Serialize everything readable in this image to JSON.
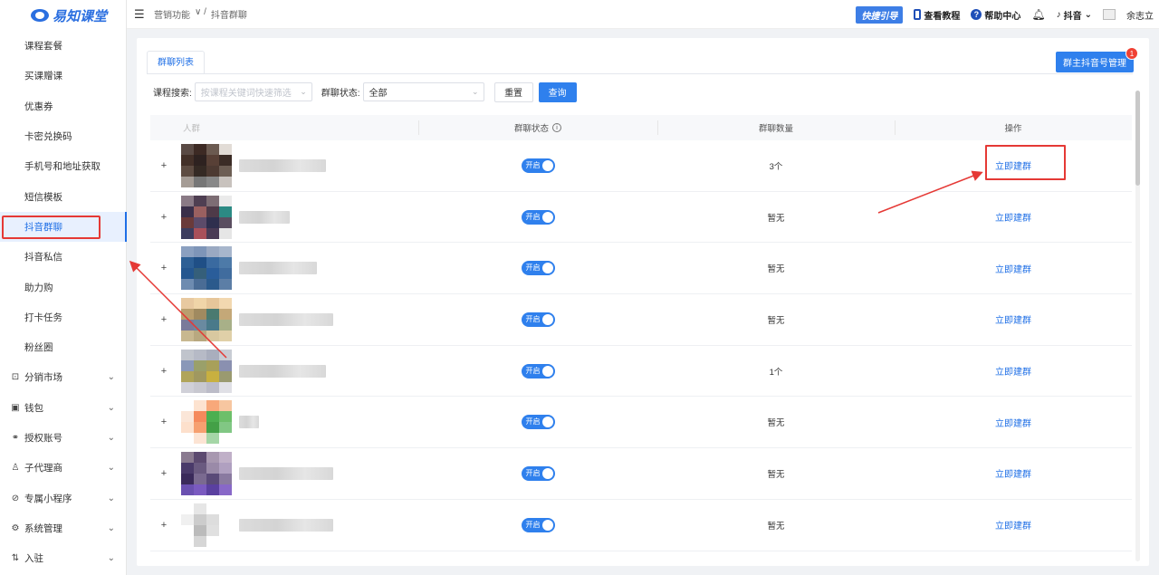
{
  "brand": {
    "name": "易知课堂"
  },
  "sidebar": {
    "items": [
      {
        "label": "课程套餐"
      },
      {
        "label": "买课赠课"
      },
      {
        "label": "优惠券"
      },
      {
        "label": "卡密兑换码"
      },
      {
        "label": "手机号和地址获取"
      },
      {
        "label": "短信模板"
      },
      {
        "label": "抖音群聊",
        "active": true
      },
      {
        "label": "抖音私信"
      },
      {
        "label": "助力购"
      },
      {
        "label": "打卡任务"
      },
      {
        "label": "粉丝圈"
      }
    ],
    "groups": [
      {
        "label": "分销市场",
        "icon": "bag-icon"
      },
      {
        "label": "钱包",
        "icon": "wallet-icon"
      },
      {
        "label": "授权账号",
        "icon": "link-icon"
      },
      {
        "label": "子代理商",
        "icon": "agent-icon"
      },
      {
        "label": "专属小程序",
        "icon": "miniapp-icon"
      },
      {
        "label": "系统管理",
        "icon": "gear-icon"
      },
      {
        "label": "入驻",
        "icon": "enter-icon"
      }
    ]
  },
  "topbar": {
    "breadcrumb": [
      "营销功能",
      "抖音群聊"
    ],
    "quick_guide": "快捷引导",
    "tutorial": "查看教程",
    "help": "帮助中心",
    "douyin": "抖音",
    "user": "余志立"
  },
  "page": {
    "tab": "群聊列表",
    "manage_button": "群主抖音号管理",
    "manage_badge": "1",
    "filters": {
      "course_label": "课程搜索:",
      "course_placeholder": "按课程关键词快速筛选",
      "status_label": "群聊状态:",
      "status_value": "全部",
      "reset": "重置",
      "query": "查询"
    },
    "table": {
      "columns": [
        "人群",
        "群聊状态",
        "群聊数量",
        "操作"
      ],
      "rows": [
        {
          "status": "开启",
          "count": "3个",
          "action": "立即建群",
          "avatar": [
            "#5a4a44",
            "#3d2a24",
            "#6b5a50",
            "#e2dcd6",
            "#433028",
            "#2e2220",
            "#584036",
            "#3b2c26",
            "#5e4c42",
            "#352a24",
            "#4d3a32",
            "#6d5e54",
            "#a59c95",
            "#777",
            "#888",
            "#c8c2bd"
          ],
          "name_w": 96
        },
        {
          "status": "开启",
          "count": "暂无",
          "action": "立即建群",
          "avatar": [
            "#8a7a86",
            "#4f3f52",
            "#7d6d74",
            "#eaeaea",
            "#3a2f4a",
            "#9a6060",
            "#4e3a48",
            "#2c8a84",
            "#6a3a3a",
            "#5c4b6a",
            "#2f2f4e",
            "#5a4e60",
            "#3c3c5e",
            "#a8505a",
            "#4a3b55",
            "#e6e6e6"
          ],
          "name_w": 56
        },
        {
          "status": "开启",
          "count": "暂无",
          "action": "立即建群",
          "avatar": [
            "#8ba0c0",
            "#7e95b8",
            "#9aa9c2",
            "#a7b6cc",
            "#2d5f95",
            "#1f4f86",
            "#3a6aa0",
            "#4d7aa8",
            "#24568f",
            "#355f7a",
            "#2a5d9a",
            "#406c9e",
            "#6d8bb0",
            "#4a6c95",
            "#2b5a8c",
            "#5c7ea6"
          ],
          "name_w": 86
        },
        {
          "status": "开启",
          "count": "暂无",
          "action": "立即建群",
          "avatar": [
            "#e8c9a0",
            "#f0d5a8",
            "#e6c69a",
            "#f2d8b0",
            "#b99e6e",
            "#a08a60",
            "#4a7a70",
            "#c4a878",
            "#7a7a9a",
            "#6a8aa0",
            "#4a7a8a",
            "#a8b088",
            "#c8b890",
            "#b8a880",
            "#d8c8a0",
            "#e0d0a8"
          ],
          "name_w": 104
        },
        {
          "status": "开启",
          "count": "1个",
          "action": "立即建群",
          "avatar": [
            "#c0c4cc",
            "#b6bac6",
            "#a9aebd",
            "#c8ccd4",
            "#8a98b8",
            "#9aa06a",
            "#a8a05a",
            "#8a90b0",
            "#b0a45a",
            "#a09860",
            "#c8b040",
            "#9a9a70",
            "#d0d0d8",
            "#c8c8d0",
            "#bcbcc8",
            "#e0e0e6"
          ],
          "name_w": 96
        },
        {
          "status": "开启",
          "count": "暂无",
          "action": "立即建群",
          "avatar": [
            "#ffffff",
            "#fde3d0",
            "#f8a87a",
            "#f7c6a0",
            "#fbe6d8",
            "#f58a5c",
            "#4caf50",
            "#6dbf6a",
            "#fde0cc",
            "#f6a070",
            "#43a047",
            "#81c784",
            "#ffffff",
            "#fce4d4",
            "#a5d6a7",
            "#ffffff"
          ],
          "name_w": 22
        },
        {
          "status": "开启",
          "count": "暂无",
          "action": "立即建群",
          "avatar": [
            "#8a7a90",
            "#5c4a70",
            "#a898b0",
            "#c0b0c8",
            "#4a3a6a",
            "#6a5a80",
            "#9a8aa8",
            "#b0a0c0",
            "#3a2a5a",
            "#7a6a90",
            "#5a4a78",
            "#8a7aa0",
            "#6a50b0",
            "#7a5ac0",
            "#5a40a0",
            "#8868c8"
          ],
          "name_w": 104
        },
        {
          "status": "开启",
          "count": "暂无",
          "action": "立即建群",
          "avatar": [
            "#ffffff",
            "#e6e6e6",
            "#ffffff",
            "#ffffff",
            "#f0f0f0",
            "#cccccc",
            "#dddddd",
            "#ffffff",
            "#ffffff",
            "#bbbbbb",
            "#e0e0e0",
            "#ffffff",
            "#ffffff",
            "#d6d6d6",
            "#ffffff",
            "#ffffff"
          ],
          "name_w": 104
        }
      ]
    }
  },
  "colors": {
    "primary": "#2f80ed",
    "annotation": "#e53935",
    "badge": "#f04134"
  }
}
